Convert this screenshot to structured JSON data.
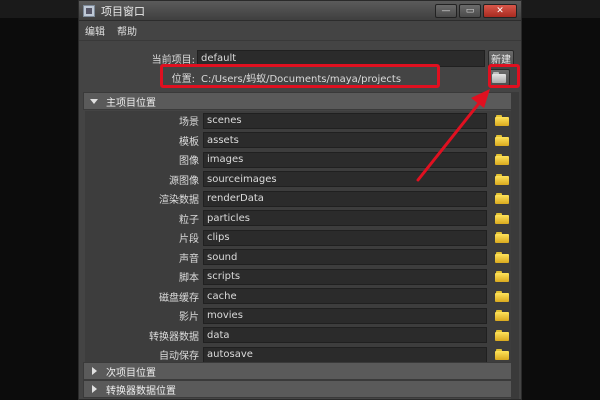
{
  "window": {
    "title": "项目窗口",
    "minimize_glyph": "—",
    "maximize_glyph": "▭",
    "close_glyph": "✕"
  },
  "menu": {
    "items": [
      "编辑",
      "帮助"
    ]
  },
  "project": {
    "current_label": "当前项目:",
    "current_value": "default",
    "new_button": "新建",
    "location_label": "位置:",
    "location_value": "C:/Users/蚂蚁/Documents/maya/projects",
    "browse_icon": "folder-icon"
  },
  "sections": {
    "primary": "主项目位置",
    "secondary": "次项目位置",
    "translator": "转换器数据位置"
  },
  "locations": [
    {
      "label": "场景",
      "value": "scenes"
    },
    {
      "label": "模板",
      "value": "assets"
    },
    {
      "label": "图像",
      "value": "images"
    },
    {
      "label": "源图像",
      "value": "sourceimages"
    },
    {
      "label": "渲染数据",
      "value": "renderData"
    },
    {
      "label": "粒子",
      "value": "particles"
    },
    {
      "label": "片段",
      "value": "clips"
    },
    {
      "label": "声音",
      "value": "sound"
    },
    {
      "label": "脚本",
      "value": "scripts"
    },
    {
      "label": "磁盘缓存",
      "value": "cache"
    },
    {
      "label": "影片",
      "value": "movies"
    },
    {
      "label": "转换器数据",
      "value": "data"
    },
    {
      "label": "自动保存",
      "value": "autosave"
    }
  ],
  "colors": {
    "highlight": "#e01020",
    "folder": "#f0c330",
    "panel": "#444444"
  }
}
